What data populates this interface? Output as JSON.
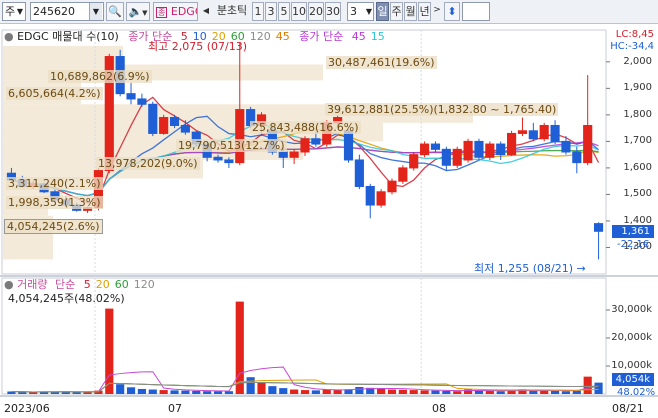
{
  "toolbar": {
    "market_label": "주",
    "stock_code": "245620",
    "stock_name": "EDGC",
    "interval_label": "분초틱",
    "minute_options": [
      "1",
      "3",
      "5",
      "10",
      "20",
      "30"
    ],
    "count_value": "3",
    "periods": [
      "일",
      "주",
      "월",
      "년"
    ],
    "selected_period": "일"
  },
  "price_panel": {
    "series_title": "EDGC 매물대 수(10)",
    "ma_label": "종가 단순",
    "ma_periods": [
      "5",
      "10",
      "20",
      "60",
      "120",
      "45"
    ],
    "ma_colors": [
      "#d2202e",
      "#1f5fd6",
      "#e0a000",
      "#2e9e37",
      "#8c8c8c",
      "#e07a00"
    ],
    "ma2_label": "종가 단순",
    "ma2_periods": [
      "45",
      "15"
    ],
    "ma2_colors": [
      "#b93ad6",
      "#29c6d6"
    ],
    "lc_text": "LC:8,45",
    "hc_text": "HC:-34,4",
    "high_text": "최고 2,075 (07/13)",
    "low_text": "최저 1,255 (08/21)",
    "current_price": "1,361",
    "current_change": "-22,1€",
    "y_ticks": [
      "2,000",
      "1,900",
      "1,800",
      "1,700",
      "1,600",
      "1,500",
      "1,400",
      "1,300"
    ],
    "volume_profile": [
      {
        "label": "30,487,461(19.6%)"
      },
      {
        "label": "39,612,881(25.5%)(1,832.80 ~ 1,765.40)"
      },
      {
        "label": "10,689,862(6.9%)"
      },
      {
        "label": "6,605,664(4.2%)"
      },
      {
        "label": "25,843,488(16.6%)"
      },
      {
        "label": "19,790,513(12.7%)"
      },
      {
        "label": "13,978,202(9.0%)"
      },
      {
        "label": "3,311,240(2.1%)"
      },
      {
        "label": "1,998,359(1.3%)"
      },
      {
        "label": "4,054,245(2.6%)"
      }
    ]
  },
  "volume_panel": {
    "title": "거래량",
    "ma_label": "단순",
    "ma_periods": [
      "5",
      "20",
      "60",
      "120"
    ],
    "ma_colors": [
      "#d2202e",
      "#e0a000",
      "#2e9e37",
      "#8c8c8c"
    ],
    "current_text": "4,054,245주(48.02%)",
    "y_ticks": [
      "30,000k",
      "20,000k",
      "10,000k"
    ],
    "right_value": "4,054k",
    "right_pct": "48.02%"
  },
  "x_axis": {
    "labels": [
      "2023/06",
      "07",
      "08",
      "08/21"
    ]
  },
  "chart_data": {
    "type": "candlestick",
    "title": "EDGC",
    "colors": {
      "up": "#e3241b",
      "down": "#1f5fd6"
    },
    "candles": [
      {
        "o": 1580,
        "h": 1600,
        "l": 1545,
        "c": 1555
      },
      {
        "o": 1555,
        "h": 1570,
        "l": 1525,
        "c": 1530
      },
      {
        "o": 1530,
        "h": 1550,
        "l": 1520,
        "c": 1540
      },
      {
        "o": 1540,
        "h": 1545,
        "l": 1505,
        "c": 1510
      },
      {
        "o": 1510,
        "h": 1520,
        "l": 1475,
        "c": 1480
      },
      {
        "o": 1480,
        "h": 1495,
        "l": 1455,
        "c": 1460
      },
      {
        "o": 1460,
        "h": 1470,
        "l": 1435,
        "c": 1440
      },
      {
        "o": 1440,
        "h": 1455,
        "l": 1430,
        "c": 1450
      },
      {
        "o": 1450,
        "h": 1600,
        "l": 1440,
        "c": 1590
      },
      {
        "o": 1590,
        "h": 2030,
        "l": 1580,
        "c": 2020
      },
      {
        "o": 2020,
        "h": 2045,
        "l": 1870,
        "c": 1880
      },
      {
        "o": 1880,
        "h": 1920,
        "l": 1840,
        "c": 1860
      },
      {
        "o": 1860,
        "h": 1880,
        "l": 1830,
        "c": 1840
      },
      {
        "o": 1840,
        "h": 1850,
        "l": 1720,
        "c": 1730
      },
      {
        "o": 1730,
        "h": 1800,
        "l": 1725,
        "c": 1790
      },
      {
        "o": 1790,
        "h": 1800,
        "l": 1750,
        "c": 1760
      },
      {
        "o": 1760,
        "h": 1780,
        "l": 1725,
        "c": 1735
      },
      {
        "o": 1735,
        "h": 1740,
        "l": 1680,
        "c": 1690
      },
      {
        "o": 1690,
        "h": 1700,
        "l": 1625,
        "c": 1640
      },
      {
        "o": 1640,
        "h": 1650,
        "l": 1620,
        "c": 1630
      },
      {
        "o": 1630,
        "h": 1640,
        "l": 1600,
        "c": 1620
      },
      {
        "o": 1620,
        "h": 2075,
        "l": 1610,
        "c": 1820
      },
      {
        "o": 1820,
        "h": 1830,
        "l": 1750,
        "c": 1760
      },
      {
        "o": 1760,
        "h": 1810,
        "l": 1720,
        "c": 1800
      },
      {
        "o": 1740,
        "h": 1760,
        "l": 1650,
        "c": 1660
      },
      {
        "o": 1660,
        "h": 1680,
        "l": 1600,
        "c": 1640
      },
      {
        "o": 1640,
        "h": 1670,
        "l": 1615,
        "c": 1660
      },
      {
        "o": 1660,
        "h": 1720,
        "l": 1645,
        "c": 1710
      },
      {
        "o": 1710,
        "h": 1740,
        "l": 1680,
        "c": 1690
      },
      {
        "o": 1690,
        "h": 1780,
        "l": 1680,
        "c": 1770
      },
      {
        "o": 1770,
        "h": 1800,
        "l": 1760,
        "c": 1790
      },
      {
        "o": 1740,
        "h": 1745,
        "l": 1620,
        "c": 1630
      },
      {
        "o": 1630,
        "h": 1650,
        "l": 1520,
        "c": 1530
      },
      {
        "o": 1530,
        "h": 1540,
        "l": 1410,
        "c": 1460
      },
      {
        "o": 1460,
        "h": 1520,
        "l": 1450,
        "c": 1510
      },
      {
        "o": 1510,
        "h": 1560,
        "l": 1500,
        "c": 1550
      },
      {
        "o": 1550,
        "h": 1610,
        "l": 1540,
        "c": 1600
      },
      {
        "o": 1600,
        "h": 1660,
        "l": 1590,
        "c": 1650
      },
      {
        "o": 1650,
        "h": 1700,
        "l": 1640,
        "c": 1690
      },
      {
        "o": 1690,
        "h": 1700,
        "l": 1660,
        "c": 1670
      },
      {
        "o": 1670,
        "h": 1680,
        "l": 1590,
        "c": 1610
      },
      {
        "o": 1610,
        "h": 1680,
        "l": 1600,
        "c": 1670
      },
      {
        "o": 1630,
        "h": 1710,
        "l": 1620,
        "c": 1700
      },
      {
        "o": 1700,
        "h": 1710,
        "l": 1630,
        "c": 1640
      },
      {
        "o": 1640,
        "h": 1700,
        "l": 1630,
        "c": 1690
      },
      {
        "o": 1690,
        "h": 1700,
        "l": 1630,
        "c": 1650
      },
      {
        "o": 1650,
        "h": 1740,
        "l": 1645,
        "c": 1730
      },
      {
        "o": 1730,
        "h": 1790,
        "l": 1720,
        "c": 1740
      },
      {
        "o": 1740,
        "h": 1770,
        "l": 1700,
        "c": 1710
      },
      {
        "o": 1710,
        "h": 1770,
        "l": 1700,
        "c": 1760
      },
      {
        "o": 1760,
        "h": 1780,
        "l": 1690,
        "c": 1700
      },
      {
        "o": 1700,
        "h": 1720,
        "l": 1650,
        "c": 1660
      },
      {
        "o": 1660,
        "h": 1680,
        "l": 1580,
        "c": 1620
      },
      {
        "o": 1620,
        "h": 1950,
        "l": 1610,
        "c": 1760
      },
      {
        "o": 1390,
        "h": 1395,
        "l": 1255,
        "c": 1361
      }
    ],
    "volume": [
      900,
      700,
      600,
      800,
      900,
      850,
      700,
      600,
      1200,
      30500,
      3500,
      2400,
      1800,
      1600,
      1400,
      1300,
      1200,
      1100,
      1000,
      950,
      1000,
      33000,
      6000,
      4200,
      2800,
      2100,
      1600,
      1400,
      1300,
      1600,
      1500,
      1700,
      2500,
      2200,
      1900,
      1600,
      1500,
      1400,
      1300,
      1200,
      1100,
      1000,
      1600,
      1300,
      1100,
      1000,
      1100,
      1700,
      1200,
      1300,
      1100,
      1000,
      1200,
      6200,
      4054
    ],
    "ylim": [
      1255,
      2075
    ],
    "volume_ylim": [
      0,
      35000
    ]
  }
}
